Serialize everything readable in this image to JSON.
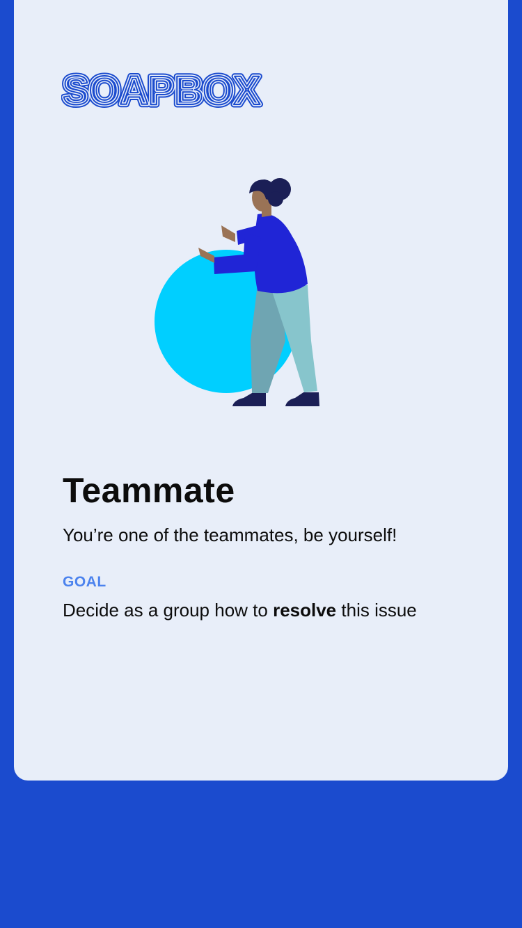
{
  "brand": {
    "logo_text": "SOAPBOX",
    "logo_color": "#1b4bce"
  },
  "colors": {
    "background": "#1b4bce",
    "card": "#e8eef9",
    "accent": "#4b82ee",
    "ball": "#00cfff",
    "shirt": "#2025d6",
    "pants": "#87c5cc",
    "hair": "#1b1f56"
  },
  "illustration": {
    "icon": "person-pushing-ball-illustration"
  },
  "role": {
    "title": "Teammate",
    "description": "You’re one of the teammates, be yourself!"
  },
  "goal": {
    "label": "GOAL",
    "text_before": "Decide as a group how to ",
    "text_bold": "resolve",
    "text_after": " this issue"
  }
}
